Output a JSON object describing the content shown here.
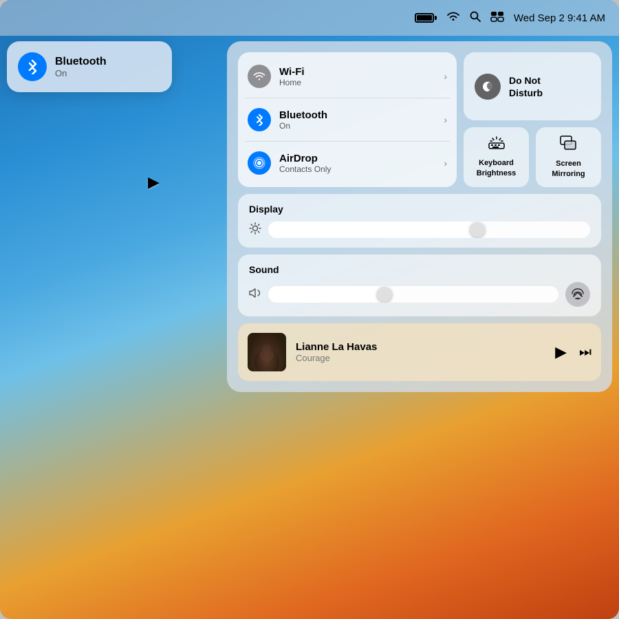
{
  "menubar": {
    "datetime": "Wed Sep 2  9:41 AM"
  },
  "bluetooth_bubble": {
    "title": "Bluetooth",
    "subtitle": "On"
  },
  "control_center": {
    "network": {
      "wifi": {
        "name": "Wi-Fi",
        "sub": "Home"
      },
      "bluetooth": {
        "name": "Bluetooth",
        "sub": "On"
      },
      "airdrop": {
        "name": "AirDrop",
        "sub": "Contacts Only"
      }
    },
    "dnd": {
      "label": "Do Not\nDisturb"
    },
    "keyboard_brightness": {
      "label": "Keyboard\nBrightness"
    },
    "screen_mirroring": {
      "label": "Screen\nMirroring"
    },
    "display": {
      "title": "Display"
    },
    "sound": {
      "title": "Sound"
    },
    "now_playing": {
      "track": "Lianne La Havas",
      "album": "Courage"
    }
  }
}
